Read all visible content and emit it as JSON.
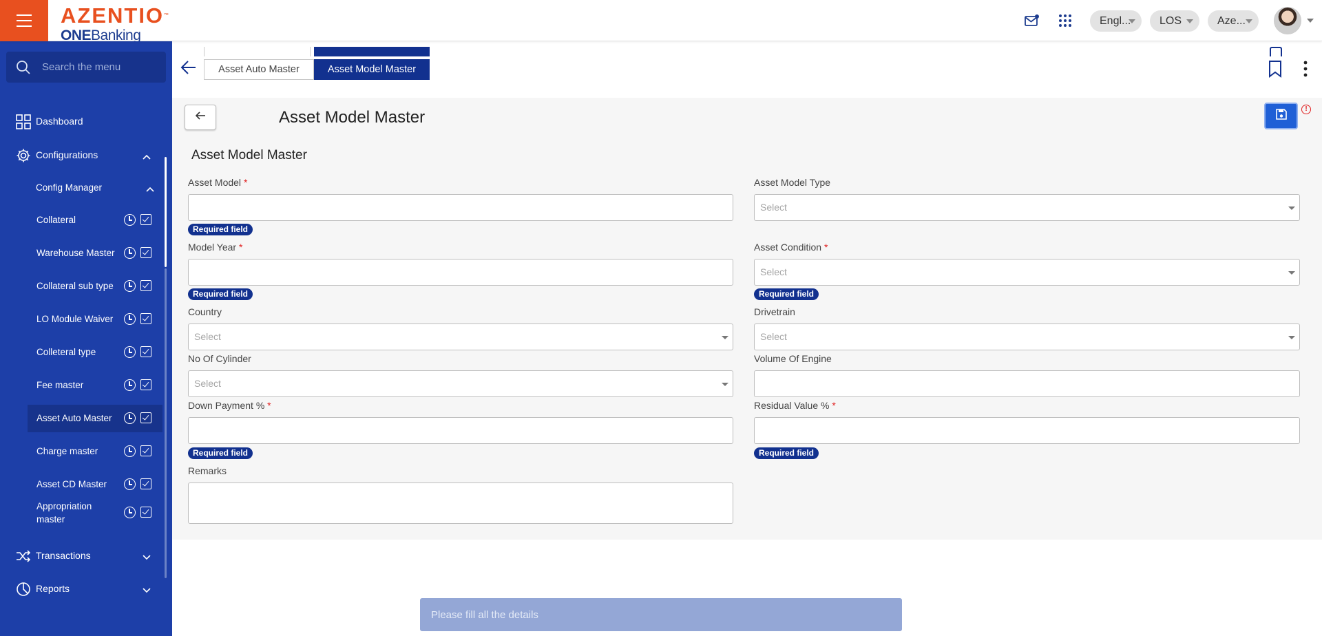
{
  "header": {
    "brand": "AZENTIO",
    "brand_tm": "™",
    "product_prefix": "ONE",
    "product_suffix": "Banking",
    "language": "Engl...",
    "module": "LOS",
    "user": "Aze..."
  },
  "sidebar": {
    "search_placeholder": "Search the menu",
    "dashboard": "Dashboard",
    "configurations": "Configurations",
    "config_manager": "Config Manager",
    "items": [
      {
        "label": "Collateral"
      },
      {
        "label": "Warehouse Master"
      },
      {
        "label": "Collateral sub type"
      },
      {
        "label": "LO Module Waiver"
      },
      {
        "label": "Colleteral type"
      },
      {
        "label": "Fee master"
      },
      {
        "label": "Asset Auto Master"
      },
      {
        "label": "Charge master"
      },
      {
        "label": "Asset CD Master"
      },
      {
        "label": "Appropriation master"
      }
    ],
    "transactions": "Transactions",
    "reports": "Reports"
  },
  "tabs": {
    "tab1": "Asset Auto Master",
    "tab2": "Asset Model Master"
  },
  "page": {
    "title": "Asset Model Master",
    "section_title": "Asset Model Master"
  },
  "form": {
    "asset_model": {
      "label": "Asset Model",
      "req": "*",
      "value": ""
    },
    "asset_model_type": {
      "label": "Asset Model Type",
      "placeholder": "Select"
    },
    "model_year": {
      "label": "Model Year",
      "req": "*",
      "value": ""
    },
    "asset_condition": {
      "label": "Asset Condition",
      "req": "*",
      "placeholder": "Select"
    },
    "country": {
      "label": "Country",
      "placeholder": "Select"
    },
    "drivetrain": {
      "label": "Drivetrain",
      "placeholder": "Select"
    },
    "no_of_cylinder": {
      "label": "No Of Cylinder",
      "placeholder": "Select"
    },
    "volume_of_engine": {
      "label": "Volume Of Engine",
      "value": ""
    },
    "down_payment": {
      "label": "Down Payment %",
      "req": "*",
      "value": ""
    },
    "residual_value": {
      "label": "Residual Value %",
      "req": "*",
      "value": ""
    },
    "remarks": {
      "label": "Remarks",
      "value": ""
    },
    "required_text": "Required field"
  },
  "toast": {
    "message": "Please fill all the details"
  },
  "colors": {
    "brand_orange": "#e8501f",
    "sidebar_blue": "#1d3fa8",
    "active_tab": "#12318f",
    "save_button": "#1f5fd6",
    "required_red": "#e02020"
  }
}
